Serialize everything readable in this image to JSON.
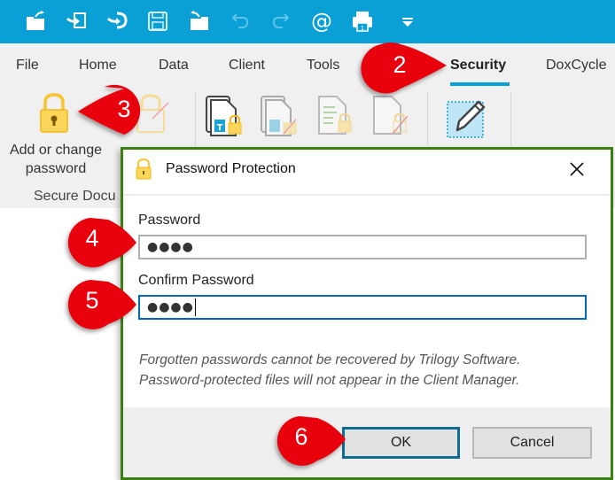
{
  "quick_access_toolbar": {
    "background": "#0aa0d6",
    "buttons": [
      {
        "icon": "folder-open-out-icon",
        "enabled": true
      },
      {
        "icon": "import-icon",
        "enabled": true
      },
      {
        "icon": "import-round-icon",
        "enabled": true
      },
      {
        "icon": "save-icon",
        "enabled": true
      },
      {
        "icon": "folder-open-back-icon",
        "enabled": true
      },
      {
        "icon": "undo-icon",
        "enabled": false
      },
      {
        "icon": "redo-icon",
        "enabled": false
      },
      {
        "icon": "email-at-icon",
        "enabled": true
      },
      {
        "icon": "print-icon",
        "enabled": true
      },
      {
        "icon": "customize-dropdown-icon",
        "enabled": true
      }
    ]
  },
  "tabs": [
    {
      "label": "File"
    },
    {
      "label": "Home"
    },
    {
      "label": "Data"
    },
    {
      "label": "Client"
    },
    {
      "label": "Tools"
    },
    {
      "label": "Security",
      "active": true
    },
    {
      "label": "DoxCycle"
    }
  ],
  "ribbon": {
    "add_password_label_line1": "Add or change",
    "add_password_label_line2": "password",
    "group_label": "Secure Docu"
  },
  "dialog": {
    "title": "Password Protection",
    "password_label": "Password",
    "password_value": "●●●●",
    "confirm_label": "Confirm Password",
    "confirm_value": "●●●●",
    "note_line1": "Forgotten passwords cannot be recovered by Trilogy Software.",
    "note_line2": "Password-protected files will not appear in the Client Manager.",
    "ok_label": "OK",
    "cancel_label": "Cancel",
    "border_color": "#3c7f11"
  },
  "callouts": [
    {
      "number": "2",
      "target": "Security tab"
    },
    {
      "number": "3",
      "target": "Add or change password"
    },
    {
      "number": "4",
      "target": "Password field"
    },
    {
      "number": "5",
      "target": "Confirm Password field"
    },
    {
      "number": "6",
      "target": "OK button"
    }
  ],
  "callout_color": "#e8000b"
}
